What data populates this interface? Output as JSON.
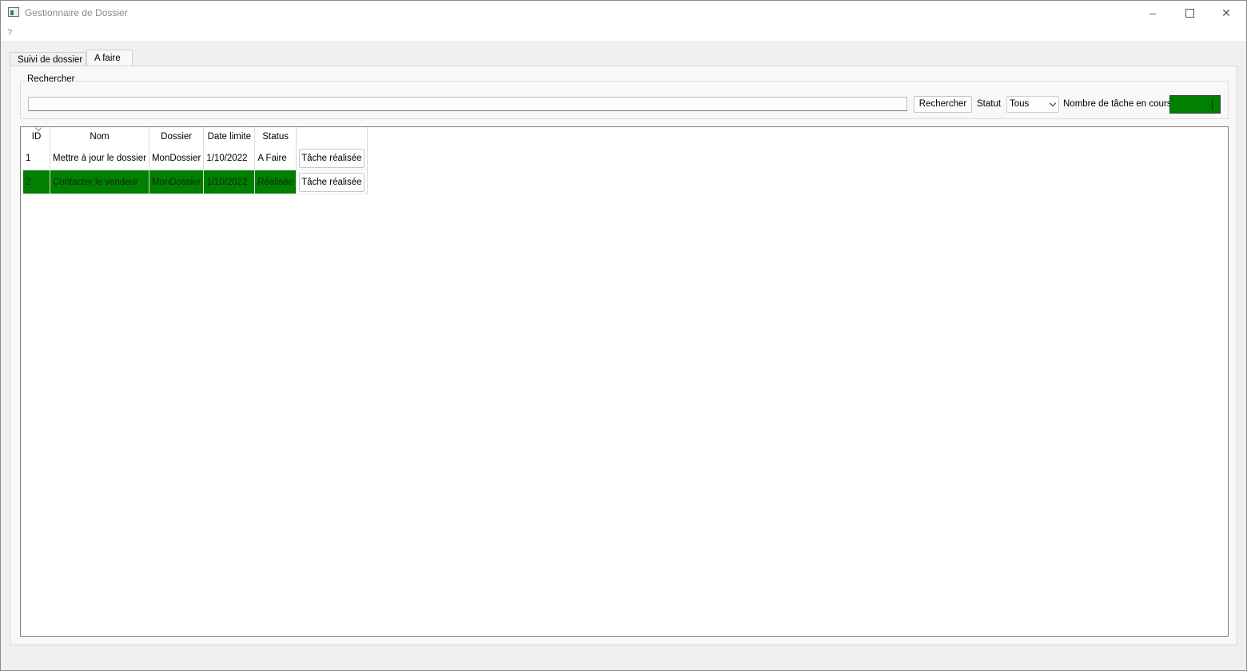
{
  "window": {
    "title": "Gestionnaire de Dossier",
    "menu_help": "?"
  },
  "tabs": [
    {
      "label": "Suivi de dossier",
      "active": false
    },
    {
      "label": "A faire",
      "active": true
    }
  ],
  "search": {
    "group_title": "Rechercher",
    "input_value": "",
    "button_label": "Rechercher",
    "status_label": "Statut",
    "status_selected": "Tous",
    "count_label": "Nombre de tâche en cours",
    "count_value": ""
  },
  "table": {
    "headers": [
      "ID",
      "Nom",
      "Dossier",
      "Date limite",
      "Status",
      ""
    ],
    "rows": [
      {
        "id": "1",
        "nom": "Mettre à jour le dossier",
        "dossier": "MonDossier",
        "date": "1/10/2022",
        "status": "A Faire",
        "action": "Tâche réalisée"
      },
      {
        "id": "2",
        "nom": "Contacter le vendeur",
        "dossier": "MonDossier",
        "date": "1/10/2022",
        "status": "Réalisée",
        "action": "Tâche réalisée"
      }
    ]
  },
  "colors": {
    "done_row": "#007f00",
    "count_box": "#007f00"
  }
}
